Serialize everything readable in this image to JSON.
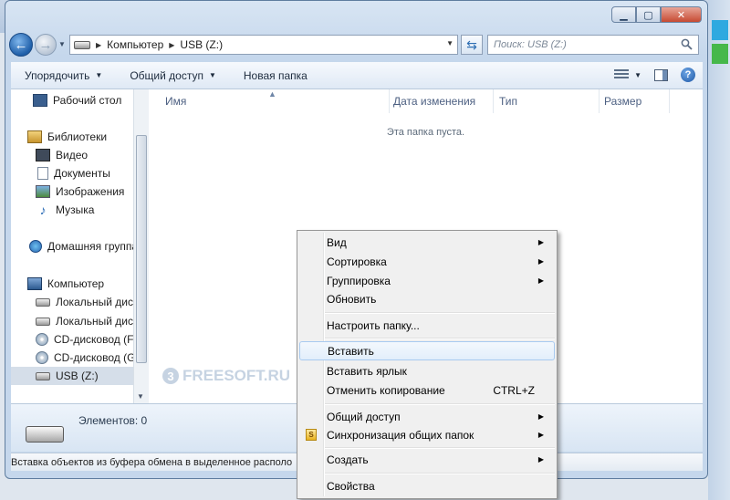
{
  "address": {
    "crumbs": [
      "Компьютер",
      "USB (Z:)"
    ],
    "search_placeholder": "Поиск: USB (Z:)"
  },
  "toolbar": {
    "organize": "Упорядочить",
    "share": "Общий доступ",
    "new_folder": "Новая папка"
  },
  "nav": {
    "items": [
      {
        "label": "Рабочий стол",
        "icon": "desktop-icon"
      },
      {
        "label": "Библиотеки",
        "icon": "libraries-icon"
      },
      {
        "label": "Видео",
        "icon": "video-icon"
      },
      {
        "label": "Документы",
        "icon": "documents-icon"
      },
      {
        "label": "Изображения",
        "icon": "pictures-icon"
      },
      {
        "label": "Музыка",
        "icon": "music-icon"
      },
      {
        "label": "Домашняя группа",
        "icon": "homegroup-icon"
      },
      {
        "label": "Компьютер",
        "icon": "computer-icon"
      },
      {
        "label": "Локальный диск",
        "icon": "local-disk-icon"
      },
      {
        "label": "Локальный диск",
        "icon": "local-disk-icon"
      },
      {
        "label": "CD-дисковод (F:",
        "icon": "cd-drive-icon"
      },
      {
        "label": "CD-дисковод (G:",
        "icon": "cd-drive-icon"
      },
      {
        "label": "USB (Z:)",
        "icon": "usb-drive-icon",
        "selected": true
      }
    ]
  },
  "columns": [
    "Имя",
    "Дата изменения",
    "Тип",
    "Размер"
  ],
  "content": {
    "empty_text": "Эта папка пуста.",
    "watermark": "FREESOFT.RU",
    "watermark_digit": "3"
  },
  "details": {
    "count": "Элементов: 0"
  },
  "status": {
    "text": "Вставка объектов из буфера обмена в выделенное располо"
  },
  "context_menu": {
    "view": "Вид",
    "sort": "Сортировка",
    "group": "Группировка",
    "refresh": "Обновить",
    "customize": "Настроить папку...",
    "paste": "Вставить",
    "paste_shortcut": "Вставить ярлык",
    "undo_copy": "Отменить копирование",
    "undo_shortcut": "CTRL+Z",
    "share": "Общий доступ",
    "sync": "Синхронизация общих папок",
    "create": "Создать",
    "properties": "Свойства"
  }
}
